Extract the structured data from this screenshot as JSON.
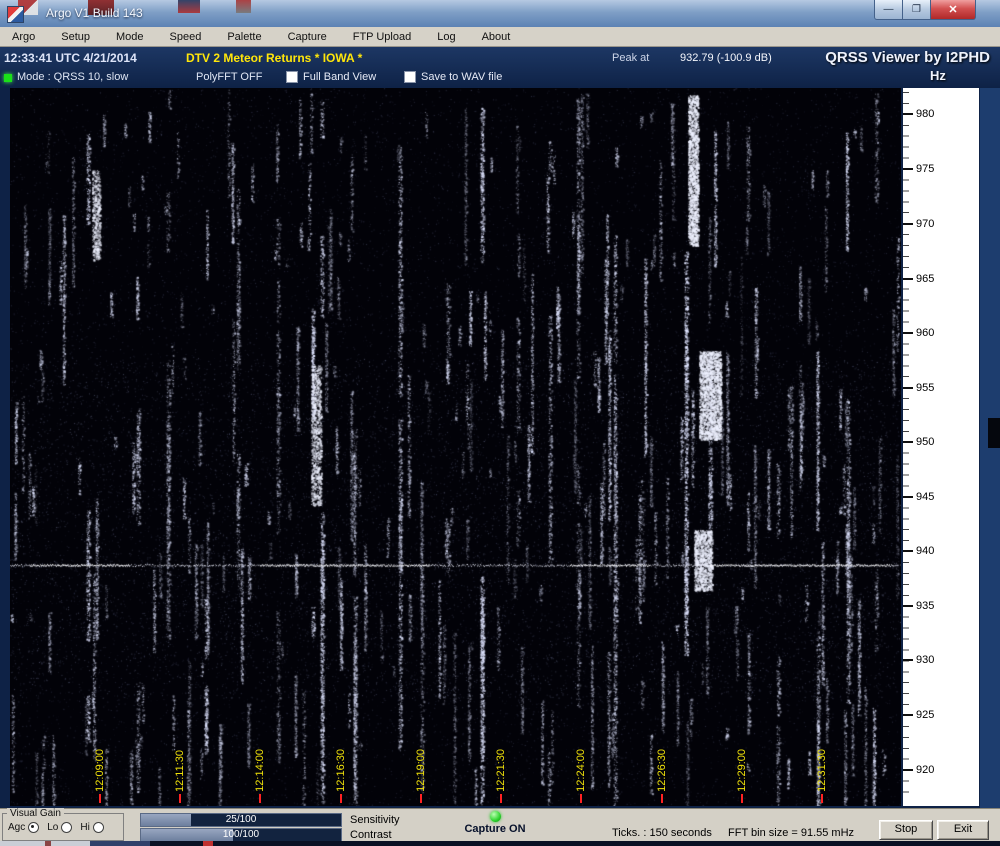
{
  "window": {
    "title": "Argo V1 Build 143",
    "minimize": "—",
    "maximize": "❐",
    "close": "✕",
    "menu": [
      "Argo",
      "Setup",
      "Mode",
      "Speed",
      "Palette",
      "Capture",
      "FTP Upload",
      "Log",
      "About"
    ]
  },
  "header": {
    "timestamp": "12:33:41 UTC  4/21/2014",
    "banner": "DTV 2 Meteor Returns * IOWA *",
    "peak_label": "Peak at",
    "peak_value": "932.79 (-100.9 dB)",
    "app_title": "QRSS Viewer by I2PHD",
    "freq_unit": "Hz"
  },
  "mode_bar": {
    "mode": "Mode : QRSS 10, slow",
    "polyfft": "PolyFFT OFF",
    "full_band_view": "Full Band View",
    "save_wav": "Save to WAV file"
  },
  "spectrogram": {
    "time_labels": [
      "12:09:00",
      "12:11:30",
      "12:14:00",
      "12:16:30",
      "12:19:00",
      "12:21:30",
      "12:24:00",
      "12:26:30",
      "12:29:00",
      "12:31:30"
    ],
    "freq_ticks": [
      "980",
      "975",
      "970",
      "965",
      "960",
      "955",
      "950",
      "945",
      "940",
      "935",
      "930",
      "925",
      "920"
    ],
    "carrier_line_hz_estimate": 938.7
  },
  "bottom": {
    "visual_gain_label": "Visual Gain",
    "agc_label": "Agc",
    "lo_label": "Lo",
    "hi_label": "Hi",
    "sensitivity_value": "25/100",
    "sensitivity_label": "Sensitivity",
    "contrast_value": "100/100",
    "contrast_label": "Contrast",
    "capture_status": "Capture ON",
    "ticks_info": "Ticks. : 150 seconds",
    "fft_info": "FFT bin size = 91.55 mHz",
    "stop_button": "Stop",
    "exit_button": "Exit"
  },
  "colors": {
    "header_navy": "#0e2246",
    "banner_yellow": "#ffe60a",
    "mode_led_green": "#1ae019",
    "time_tick_red": "#ff2222",
    "time_label_yellow": "#f0e10a",
    "capture_led_green": "#2ed32e"
  }
}
